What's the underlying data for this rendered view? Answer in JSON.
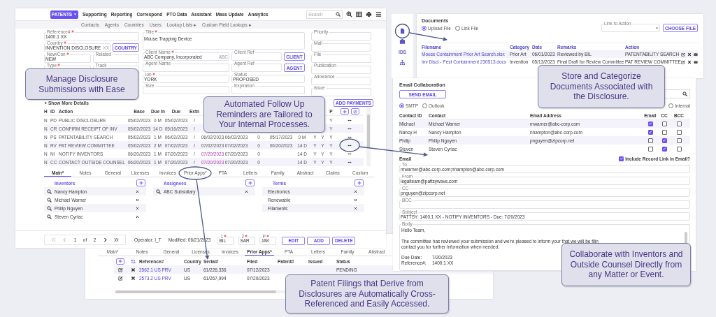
{
  "main_window": {
    "nav": {
      "menu": "PATENTS",
      "items": [
        "Supporting",
        "Reporting",
        "Correspond",
        "PTO Data",
        "Assistant",
        "Mass Update",
        "Analytics"
      ],
      "search": {
        "placeholder": "Search"
      }
    },
    "subnav": [
      "Contacts",
      "Agents",
      "Countries",
      "Users",
      "Lookup Lists ▸",
      "Custom Field Lookups ▸"
    ],
    "form_columns": [
      {
        "rows": [
          {
            "items": [
              {
                "kind": "field",
                "label": "Reference#",
                "required": true,
                "value": "1400.1 XX"
              }
            ]
          },
          {
            "items": [
              {
                "kind": "field",
                "label": "Country",
                "required": true,
                "value": "INVENTION DISCLOSURE",
                "suffix": "XX"
              },
              {
                "kind": "button",
                "label": "COUNTRY"
              }
            ]
          },
          {
            "items": [
              {
                "kind": "field",
                "label": "New/Con",
                "required": true,
                "value": "NEW"
              },
              {
                "kind": "field",
                "label": "Related",
                "required": false
              }
            ]
          },
          {
            "items": [
              {
                "kind": "field",
                "label": "Type",
                "required": true
              },
              {
                "kind": "field",
                "label": "Track",
                "required": false
              }
            ]
          }
        ]
      },
      {
        "rows": [
          {
            "items": [
              {
                "kind": "textarea",
                "label": "Title",
                "required": true,
                "value": "Mouse Trapping Device"
              }
            ]
          },
          {
            "items": [
              {
                "kind": "field",
                "label": "Client Name",
                "required": true,
                "value": "ABC Company, Incorporated",
                "suffix": "ABC"
              },
              {
                "kind": "field",
                "label": "Client Ref",
                "required": false
              },
              {
                "kind": "button",
                "label": "CLIENT"
              }
            ]
          },
          {
            "items": [
              {
                "kind": "field",
                "label": "Agent Name",
                "required": false
              },
              {
                "kind": "field",
                "label": "Agent Ref",
                "required": false
              },
              {
                "kind": "button",
                "label": "AGENT"
              }
            ]
          },
          {
            "items": [
              {
                "kind": "field",
                "label": "ion",
                "required": true,
                "value": "YORK"
              },
              {
                "kind": "field",
                "label": "Status",
                "required": false,
                "value": "PROPOSED"
              }
            ]
          },
          {
            "items": [
              {
                "kind": "field",
                "label": "Size",
                "required": false
              },
              {
                "kind": "field",
                "label": "Expiration",
                "required": false
              }
            ]
          }
        ]
      },
      {
        "rows": [
          {
            "items": [
              {
                "kind": "field",
                "label": "Priority",
                "required": false
              }
            ]
          },
          {
            "items": [
              {
                "kind": "field",
                "label": "Mail",
                "required": false
              }
            ]
          },
          {
            "items": [
              {
                "kind": "field",
                "label": "File",
                "required": false
              }
            ]
          },
          {
            "items": [
              {
                "kind": "field",
                "label": "Publication",
                "required": false
              }
            ]
          },
          {
            "items": [
              {
                "kind": "field",
                "label": "Allowance",
                "required": false
              }
            ]
          },
          {
            "items": [
              {
                "kind": "field",
                "label": "Issue",
                "required": false
              }
            ]
          }
        ]
      }
    ],
    "show_more": "Show More Details",
    "add_payments": "ADD PAYMENTS",
    "table": {
      "columns": [
        "H",
        "ID",
        "Action",
        "Base",
        "Due In",
        "Due",
        "Extn"
      ],
      "column_p": "P",
      "rows": [
        {
          "h": "N",
          "id": "PD",
          "action": "PUBLIC DISCLOSURE",
          "base": "05/02/2023",
          "due_in": "0 M",
          "due": "05/02/2023",
          "extn": "/",
          "p": "Y"
        },
        {
          "h": "N",
          "id": "CR",
          "action": "CONFIRM RECEIPT OF INV",
          "base": "05/02/2023",
          "due_in": "14 D",
          "due": "05/16/2023",
          "extn": "/",
          "p": "Y"
        },
        {
          "h": "N",
          "id": "PS",
          "action": "PATENTABILITY SEARCH",
          "base": "05/02/2023",
          "due_in": "1 M",
          "due": "06/02/2023",
          "extn": "/",
          "column_8": "06/02/2023",
          "column_9": "06/02/2023",
          "column_10": "0",
          "column_11": "05/17/2023",
          "column_12": "0 M",
          "column_13": "Y",
          "column_14": "Y",
          "p": "Y",
          "overdue": false
        },
        {
          "h": "N",
          "id": "RV",
          "action": "PAT REVIEW COMMITTEE",
          "base": "05/02/2023",
          "due_in": "2 M",
          "due": "07/02/2023",
          "extn": "/",
          "column_8": "07/02/2023",
          "column_9": "07/02/2023",
          "column_10": "0",
          "column_11": "06/20/2023",
          "column_12": "14 D",
          "column_13": "Y",
          "column_14": "Y",
          "p": "Y",
          "overdue": false
        },
        {
          "h": "N",
          "id": "NI",
          "action": "NOTIFY INVENTORS",
          "base": "06/20/2023",
          "due_in": "1 M",
          "due": "07/20/2023",
          "extn": "/",
          "column_8": "07/20/2023",
          "column_9": "07/20/2023",
          "column_10": "0",
          "column_12": "14 D",
          "column_13": "Y",
          "column_14": "Y",
          "p": "Y",
          "overdue": true
        },
        {
          "h": "N",
          "id": "CC",
          "action": "CONTACT OUTSIDE COUNSEL",
          "base": "06/20/2023",
          "due_in": "1 M",
          "due": "07/20/2023",
          "extn": "/",
          "column_8": "07/20/2023",
          "column_9": "07/20/2023",
          "column_10": "0",
          "column_12": "14 D",
          "column_13": "Y",
          "column_14": "Y",
          "p": "Y",
          "overdue": true
        }
      ]
    },
    "tabs": [
      {
        "label": "Main*",
        "selected": true
      },
      {
        "label": "Notes",
        "selected": false
      },
      {
        "label": "General",
        "selected": false
      },
      {
        "label": "Licenses",
        "selected": false
      },
      {
        "label": "Invoices",
        "selected": false
      },
      {
        "label": "Prior Apps*",
        "selected": false
      },
      {
        "label": "PTA",
        "selected": false
      },
      {
        "label": "Letters",
        "selected": false
      },
      {
        "label": "Family",
        "selected": false
      },
      {
        "label": "Abstract",
        "selected": false
      },
      {
        "label": "Claims",
        "selected": false
      },
      {
        "label": "Custom",
        "selected": false
      }
    ],
    "lists": [
      {
        "title": "Inventors",
        "kind": "lookup",
        "items": [
          "Nancy Hampton",
          "Michael Warner",
          "Philip Nguyen",
          "Steven Cyriac"
        ]
      },
      {
        "title": "Assignees",
        "kind": "lookup",
        "items": [
          "ABC Subsidiary"
        ]
      },
      {
        "title": "Terms",
        "kind": "plain",
        "items": [
          "Electronics",
          "Renewable",
          "Filaments"
        ]
      }
    ],
    "footer": {
      "pagination": {
        "page": "1",
        "of": "of",
        "total": "2",
        "at_start": true
      },
      "operator": "Operator: I_T",
      "modified": "Modified: 06/21/2023",
      "initials": [
        {
          "label": "1",
          "required": true,
          "value": "BIL"
        },
        {
          "label": "2",
          "required": true,
          "value": "SAR"
        },
        {
          "label": "P",
          "required": true,
          "value": "JAK"
        }
      ],
      "buttons": [
        "EDIT",
        "ADD",
        "DELETE"
      ]
    }
  },
  "prior_apps_panel": {
    "tabs": [
      {
        "label": "Main*",
        "selected": false
      },
      {
        "label": "Notes",
        "selected": false
      },
      {
        "label": "General",
        "selected": false
      },
      {
        "label": "Licenses",
        "selected": false
      },
      {
        "label": "Invoices",
        "selected": false
      },
      {
        "label": "Prior Apps*",
        "selected": true
      },
      {
        "label": "PTA",
        "selected": false
      },
      {
        "label": "Letters",
        "selected": false
      },
      {
        "label": "Family",
        "selected": false
      },
      {
        "label": "Abstract",
        "selected": false
      }
    ],
    "columns": [
      "Reference#",
      "Country",
      "Serial#",
      "Filed",
      "Patent#",
      "Issued",
      "Status"
    ],
    "rows": [
      {
        "reference": "2562.1 US PRV",
        "country": "US",
        "serial": "61/226,336",
        "filed": "07/12/2023",
        "status": "PENDING"
      },
      {
        "reference": "2573.2 US PRV",
        "country": "US",
        "serial": "61/267,994",
        "filed": "07/20/2023"
      }
    ]
  },
  "side_toolbar": {
    "label": "IDS"
  },
  "documents_panel": {
    "title": "Documents",
    "radios": [
      {
        "label": "Upload File",
        "selected": true
      },
      {
        "label": "Link File",
        "selected": false
      }
    ],
    "link_select": {
      "label": "Link to Action"
    },
    "button": "CHOOSE FILE",
    "columns": [
      "Filename",
      "Category",
      "Date",
      "Remarks",
      "Action"
    ],
    "rows": [
      {
        "filename": "Mouse Containment Prior Art Search.xlsx",
        "category": "Prior Art",
        "date": "06/01/2023",
        "remarks": "Reviewed by BIL",
        "action": "PATENTABILITY SEARCH"
      },
      {
        "filename": "Inv Discl - Pest Containment 230513.docx",
        "category": "Invention",
        "date": "05/13/2023",
        "remarks": "Final Draft for Review Committee",
        "action": "PAT REVIEW COMMITTEE"
      }
    ]
  },
  "email_panel": {
    "title": "Email Collaboration",
    "button": "SEND EMAIL",
    "radios": [
      {
        "label": "SMTP",
        "selected": true
      },
      {
        "label": "Outlook",
        "selected": false
      },
      {
        "label": "Internal",
        "selected": false
      }
    ],
    "columns": [
      "Contact ID",
      "Contact",
      "Email Address",
      "Email",
      "CC",
      "BCC"
    ],
    "contacts": [
      {
        "id": "Michael",
        "name": "Michael Warner",
        "address": "mwarner@abc-corp.com",
        "email": true,
        "cc": false,
        "bcc": false
      },
      {
        "id": "Nancy H",
        "name": "Nancy Hampton",
        "address": "nhampton@abc-corp.com",
        "email": true,
        "cc": false,
        "bcc": false
      },
      {
        "id": "Philip",
        "name": "Philip Nguyen",
        "address": "pnguyen@zipcorp.net",
        "email": false,
        "cc": true,
        "bcc": false
      },
      {
        "id": "Steven",
        "name": "Steven Cyriac",
        "email": false,
        "cc": true,
        "bcc": false
      }
    ],
    "section_label": "Email",
    "include_link": {
      "label": "Include Record Link in Email?",
      "checked": true
    },
    "fields": [
      {
        "label": "To",
        "value": "mwarner@abc-corp.com;nhampton@abc-corp.com"
      },
      {
        "label": "From",
        "value": "legalteam@pattsywave.com"
      },
      {
        "label": "CC",
        "value": "pnguyen@zipcorp.net"
      },
      {
        "label": "BCC"
      },
      {
        "label": "Subject",
        "value": "PATTSY: 1400.1 XX - NOTIFY INVENTORS - Due: 7/20/2023"
      }
    ],
    "body": {
      "label": "Body",
      "lines": [
        "Hello Team,",
        "The committee has reviewed your submission and we're pleased to inform your that we will be filin",
        "contact you for further information when needed."
      ],
      "facts": [
        {
          "label": "Due Date:",
          "value": "7/20/2023"
        },
        {
          "label": "Reference#:",
          "value": "1400.1 XX"
        }
      ]
    }
  },
  "callouts": [
    "Manage Disclosure Submissions with Ease",
    "Automated Follow Up Reminders are Tailored to Your Internal Processes.",
    "Store and Categorize Documents Associated with the Disclosure.",
    "Collaborate with Inventors and Outside Counsel Directly from any Matter or Event.",
    "Patent Filings that Derive from Disclosures are Automatically Cross-Referenced and Easily Accessed."
  ]
}
